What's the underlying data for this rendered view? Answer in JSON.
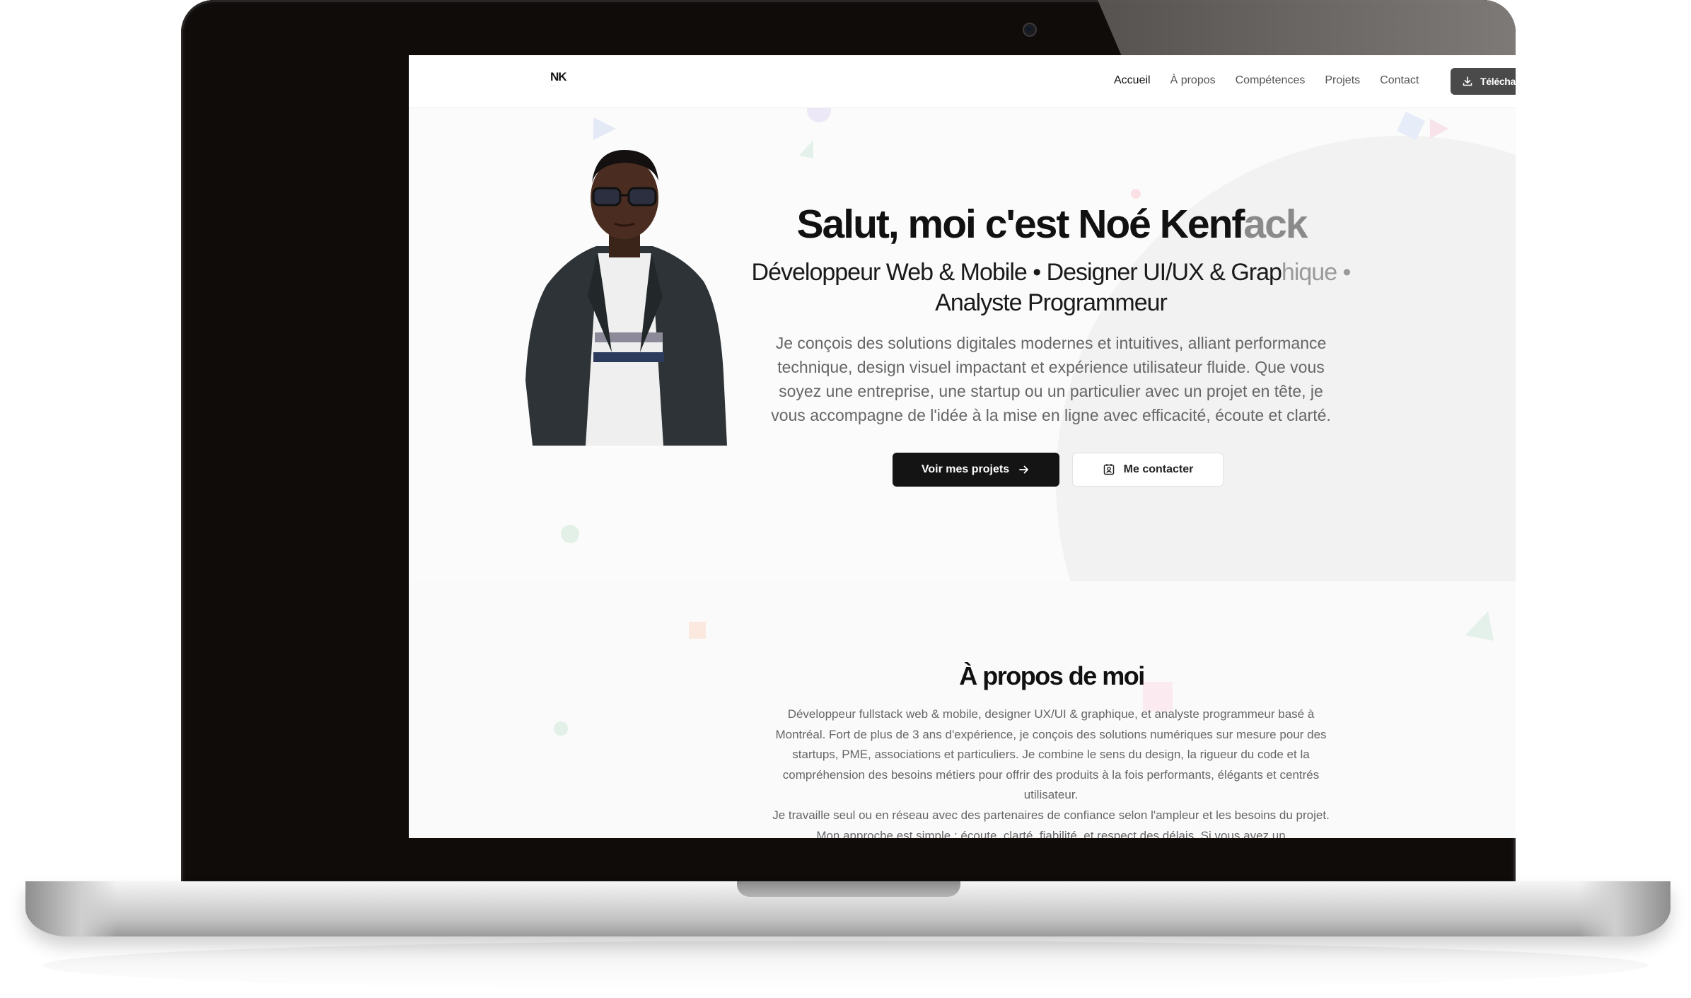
{
  "nav": {
    "logo_text": "NK",
    "links": [
      "Accueil",
      "À propos",
      "Compétences",
      "Projets",
      "Contact"
    ],
    "active": "Accueil",
    "cv_button": "Télécharger CV",
    "cv_icon": "download-icon"
  },
  "hero": {
    "title_main": "Salut, moi c'est Noé Kenf",
    "title_tail": "ack",
    "subtitle_line1_main": "Développeur Web & Mobile • Designer UI/UX & Grap",
    "subtitle_line1_tail": "hique •",
    "subtitle_line2": "Analyste Programmeur",
    "description": "Je conçois des solutions digitales modernes et intuitives, alliant performance technique, design visuel impactant et expérience utilisateur fluide. Que vous soyez une entreprise, une startup ou un particulier avec un projet en tête, je vous accompagne de l'idée à la mise en ligne avec efficacité, écoute et clarté.",
    "primary_button": "Voir mes projets",
    "primary_icon": "arrow-right-icon",
    "secondary_button": "Me contacter",
    "secondary_icon": "contact-card-icon"
  },
  "about": {
    "title": "À propos de moi",
    "paragraph1": "Développeur fullstack web & mobile, designer UX/UI & graphique, et analyste programmeur basé à Montréal. Fort de plus de 3 ans d'expérience, je conçois des solutions numériques sur mesure pour des startups, PME, associations et particuliers. Je combine le sens du design, la rigueur du code et la compréhension des besoins métiers pour offrir des produits à la fois performants, élégants et centrés utilisateur.",
    "paragraph2": "Je travaille seul ou en réseau avec des partenaires de confiance selon l'ampleur et les besoins du projet. Mon approche est simple : écoute, clarté, fiabilité, et respect des délais. Si vous avez un"
  },
  "colors": {
    "frame": "#0f0c0a",
    "primary_button": "#141414",
    "cv_button": "#4a4a4a",
    "text_dark": "#111111",
    "text_muted": "#666666"
  }
}
